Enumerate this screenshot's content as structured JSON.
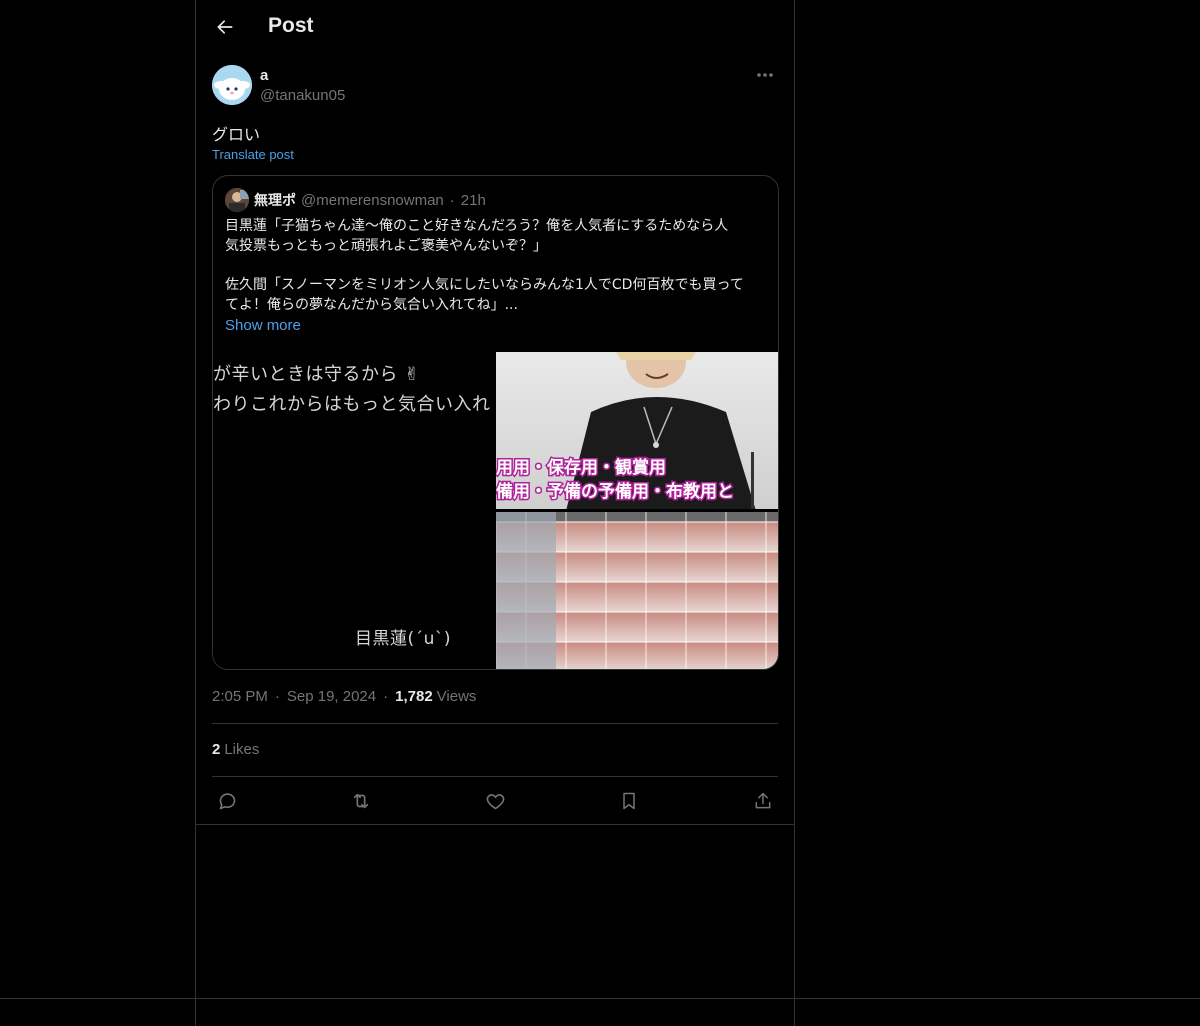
{
  "header": {
    "title": "Post",
    "back_icon": "arrow-left-icon"
  },
  "post": {
    "author": {
      "display_name": "a",
      "handle": "@tanakun05",
      "avatar_icon": "cartoon-avatar-icon"
    },
    "more_icon": "more-horizontal-icon",
    "text": "グロい",
    "translate_label": "Translate post"
  },
  "quote": {
    "author": {
      "display_name": "無理ポ",
      "handle": "@memerensnowman",
      "time": "21h"
    },
    "paragraph1_line1": "目黒蓮「子猫ちゃん達〜俺のこと好きなんだろう？俺を人気者にするためなら人",
    "paragraph1_line2": "気投票もっともっと頑張れよご褒美やんないぞ？」",
    "paragraph2_line1": "佐久間「スノーマンをミリオン人気にしたいならみんな1人でCD何百枚でも買って",
    "paragraph2_line2": "てよ！俺らの夢なんだから気合い入れてね」...",
    "show_more_label": "Show more",
    "media_left": {
      "caption1": "が辛いときは守るから ✌",
      "caption2": "わりこれからはもっと気合い入れ",
      "caption3": "目黒蓮(´u`)"
    },
    "media_right": {
      "overlay_line1": "用用・保存用・観賞用",
      "overlay_line2": "備用・予備の予備用・布教用と"
    }
  },
  "meta": {
    "time": "2:05 PM",
    "date": "Sep 19, 2024",
    "views_count": "1,782",
    "views_label": "Views",
    "separator": "·"
  },
  "likes": {
    "count": "2",
    "label": "Likes"
  },
  "actions": {
    "reply_icon": "reply-icon",
    "repost_icon": "repost-icon",
    "like_icon": "heart-icon",
    "bookmark_icon": "bookmark-icon",
    "share_icon": "share-icon"
  },
  "colors": {
    "background": "#000000",
    "border": "#2f3336",
    "text": "#e7e9ea",
    "muted": "#71767b",
    "link": "#4e9fe8",
    "overlay_stroke": "#b0209a"
  }
}
